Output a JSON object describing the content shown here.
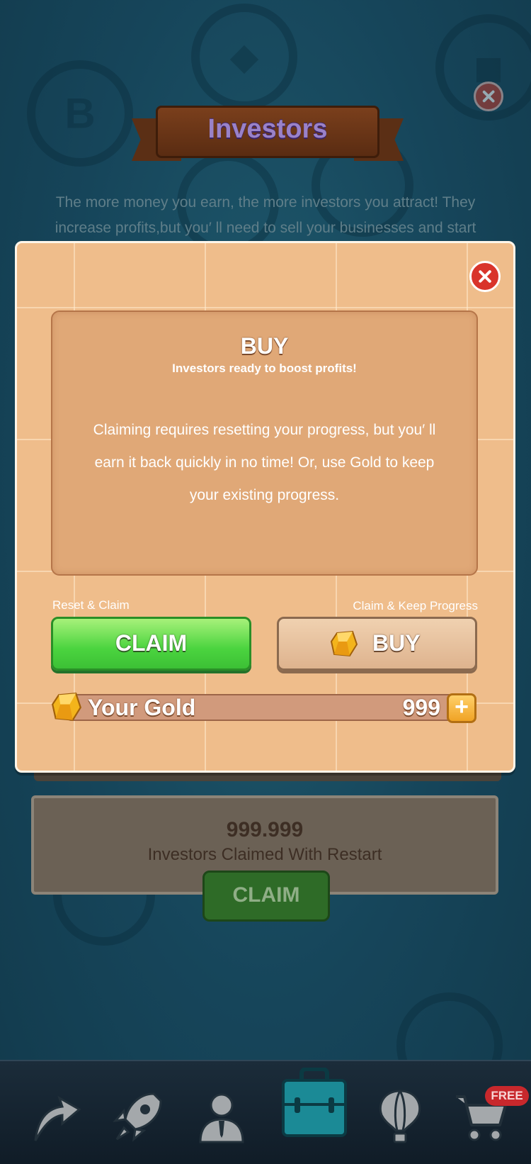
{
  "page": {
    "title": "Investors",
    "intro_text": "The more money you earn, the more investors you attract! They increase profits,but you′ ll need to sell your businesses and start"
  },
  "background_card": {
    "value": "999.999",
    "label": "Investors Claimed With Restart",
    "claim_label": "CLAIM"
  },
  "modal": {
    "title": "BUY",
    "subtitle": "Investors ready to boost profits!",
    "body": "Claiming requires resetting your progress, but you′ ll earn it back quickly in no time! Or, use Gold to keep your existing progress.",
    "left_option_label": "Reset & Claim",
    "right_option_label": "Claim & Keep Progress",
    "claim_button": "CLAIM",
    "buy_button": "BUY",
    "gold_label": "Your Gold",
    "gold_value": "999",
    "plus_symbol": "+"
  },
  "nav": {
    "items": [
      "upgrade-arrow-icon",
      "rocket-icon",
      "manager-person-icon",
      "briefcase-icon",
      "hot-air-balloon-icon",
      "shopping-cart-icon"
    ],
    "free_badge": "FREE"
  },
  "colors": {
    "modal_bg": "#efbd8b",
    "claim_green": "#4bd43f",
    "close_red": "#d9342b",
    "active_nav": "#1b8a96"
  }
}
